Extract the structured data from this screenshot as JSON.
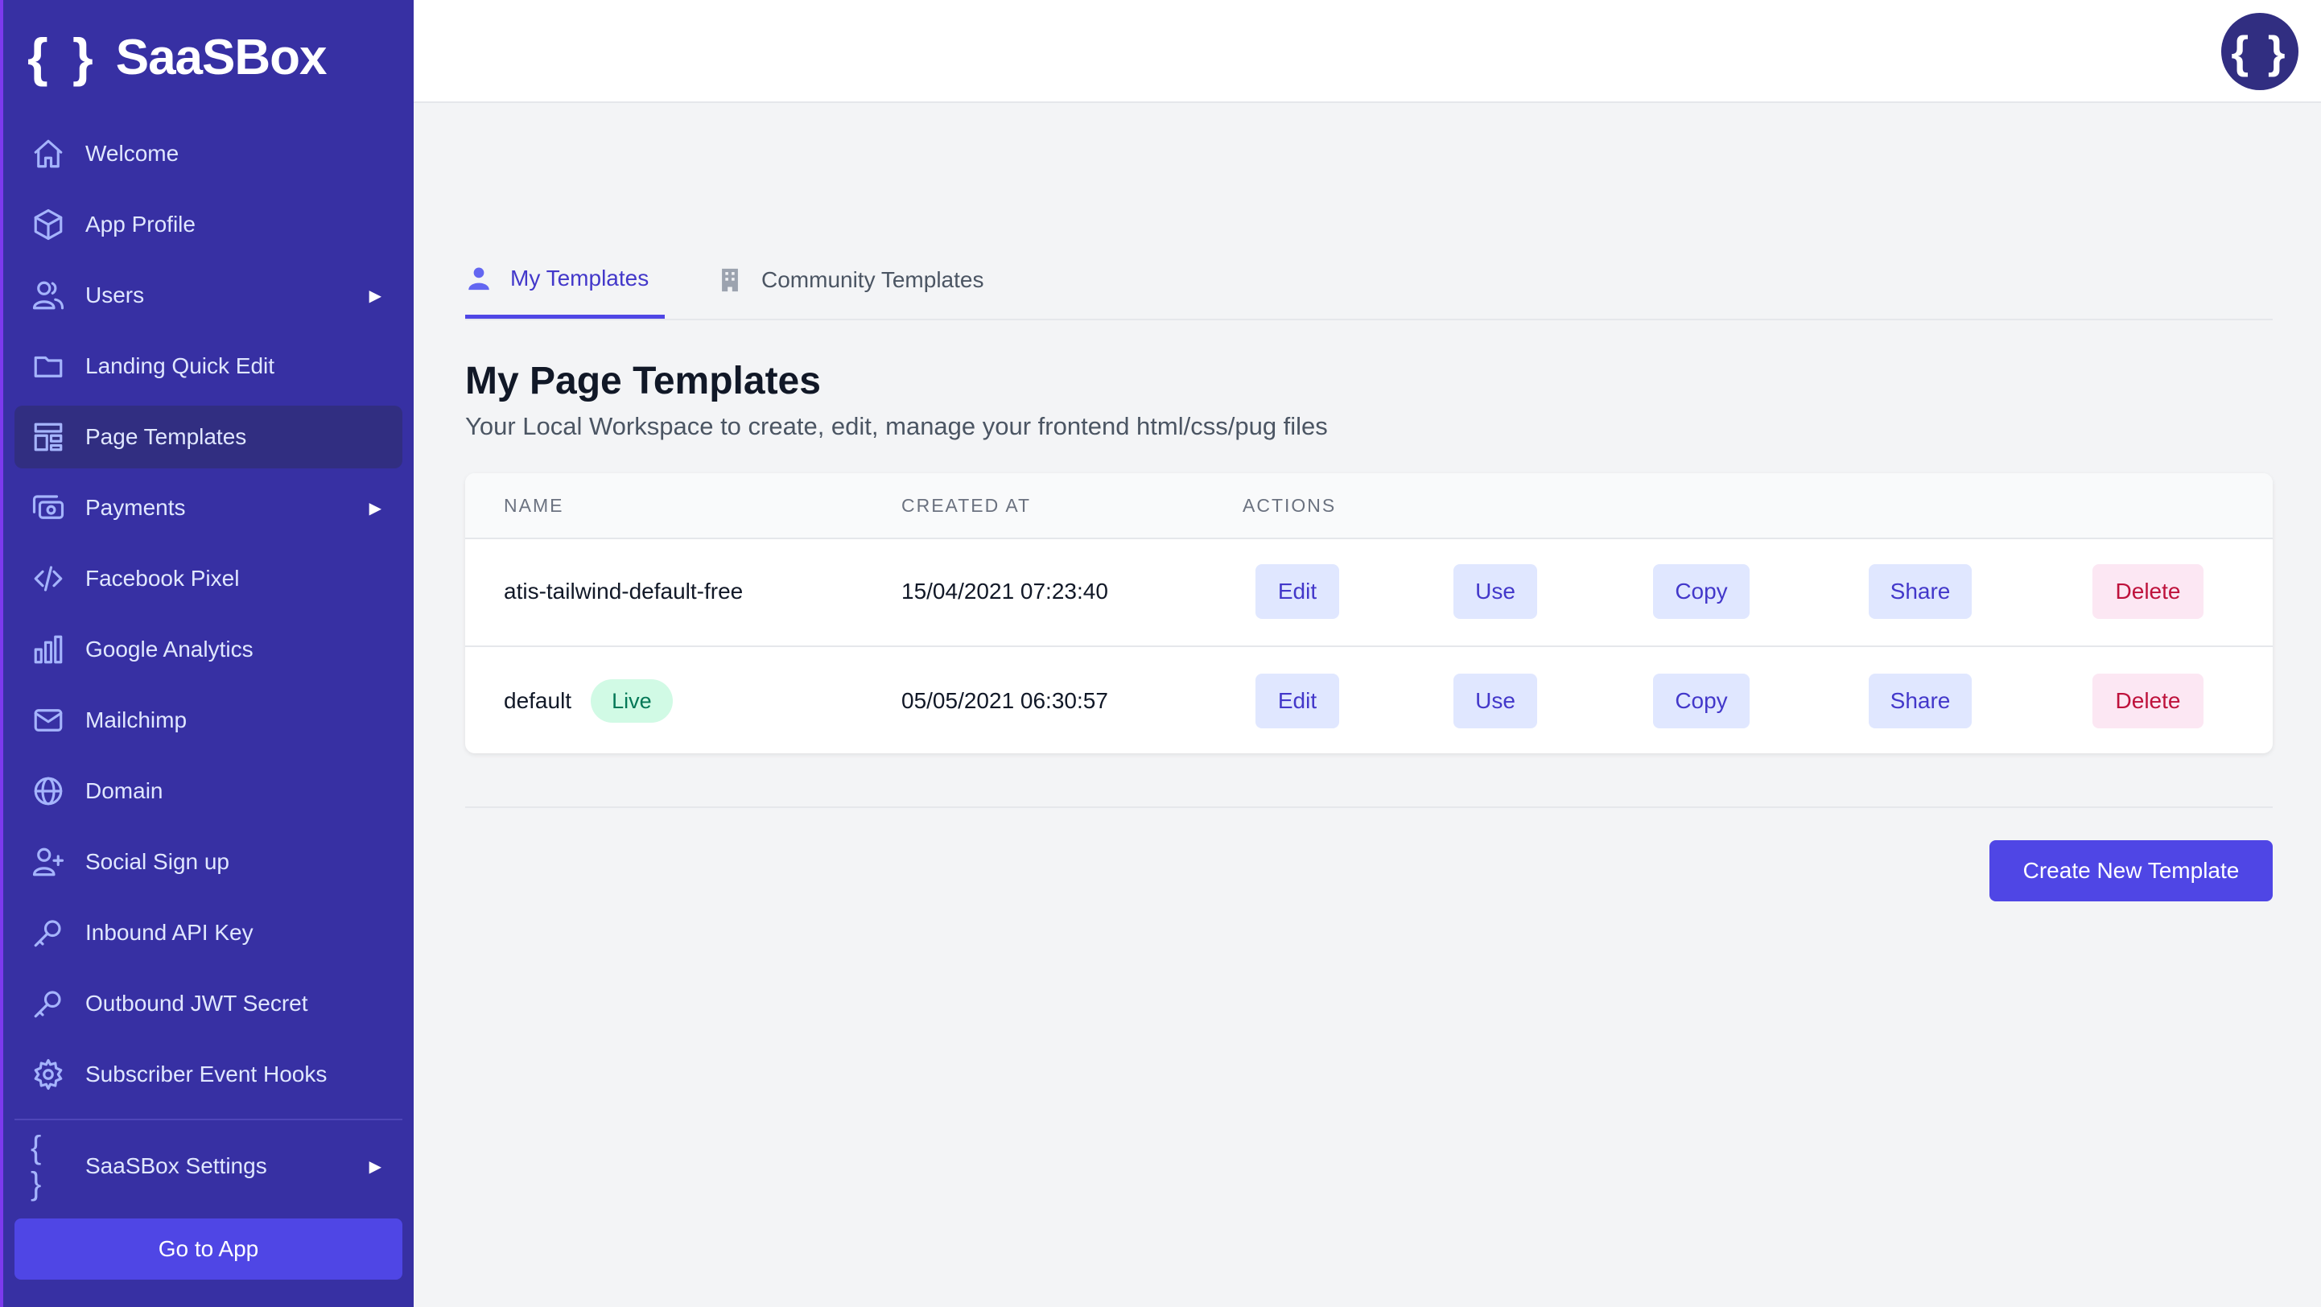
{
  "brand": {
    "mark": "{ }",
    "name": "SaaSBox"
  },
  "sidebar": {
    "items": [
      {
        "label": "Welcome",
        "icon": "home-icon"
      },
      {
        "label": "App Profile",
        "icon": "cube-icon"
      },
      {
        "label": "Users",
        "icon": "users-icon",
        "expandable": true
      },
      {
        "label": "Landing Quick Edit",
        "icon": "folder-icon"
      },
      {
        "label": "Page Templates",
        "icon": "template-icon",
        "active": true
      },
      {
        "label": "Payments",
        "icon": "cash-icon",
        "expandable": true
      },
      {
        "label": "Facebook Pixel",
        "icon": "code-icon"
      },
      {
        "label": "Google Analytics",
        "icon": "chart-bar-icon"
      },
      {
        "label": "Mailchimp",
        "icon": "mail-icon"
      },
      {
        "label": "Domain",
        "icon": "globe-icon"
      },
      {
        "label": "Social Sign up",
        "icon": "user-add-icon"
      },
      {
        "label": "Inbound API Key",
        "icon": "key-icon"
      },
      {
        "label": "Outbound JWT Secret",
        "icon": "key-icon"
      },
      {
        "label": "Subscriber Event Hooks",
        "icon": "cog-icon"
      }
    ],
    "settings": {
      "label": "SaaSBox Settings",
      "mark": "{ }",
      "expandable": true
    },
    "go_app_label": "Go to App"
  },
  "header": {
    "avatar_mark": "{ }"
  },
  "tabs": [
    {
      "label": "My Templates",
      "icon": "user-icon",
      "active": true
    },
    {
      "label": "Community Templates",
      "icon": "office-building-icon",
      "active": false
    }
  ],
  "page": {
    "title": "My Page Templates",
    "subtitle": "Your Local Workspace to create, edit, manage your frontend html/css/pug files"
  },
  "table": {
    "headers": {
      "name": "NAME",
      "created_at": "CREATED AT",
      "actions": "ACTIONS"
    },
    "rows": [
      {
        "name": "atis-tailwind-default-free",
        "badge": "",
        "created_at": "15/04/2021 07:23:40"
      },
      {
        "name": "default",
        "badge": "Live",
        "created_at": "05/05/2021 06:30:57"
      }
    ],
    "actions": {
      "edit": "Edit",
      "use": "Use",
      "copy": "Copy",
      "share": "Share",
      "delete": "Delete"
    }
  },
  "create_button_label": "Create New Template",
  "colors": {
    "sidebar_bg": "#3730a3",
    "sidebar_active_bg": "#312e81",
    "accent": "#4f46e5",
    "action_bg": "#e0e7ff",
    "delete_bg": "#fce7f3",
    "delete_text": "#be123c",
    "live_badge_bg": "#d1fae5",
    "live_badge_text": "#047857"
  }
}
